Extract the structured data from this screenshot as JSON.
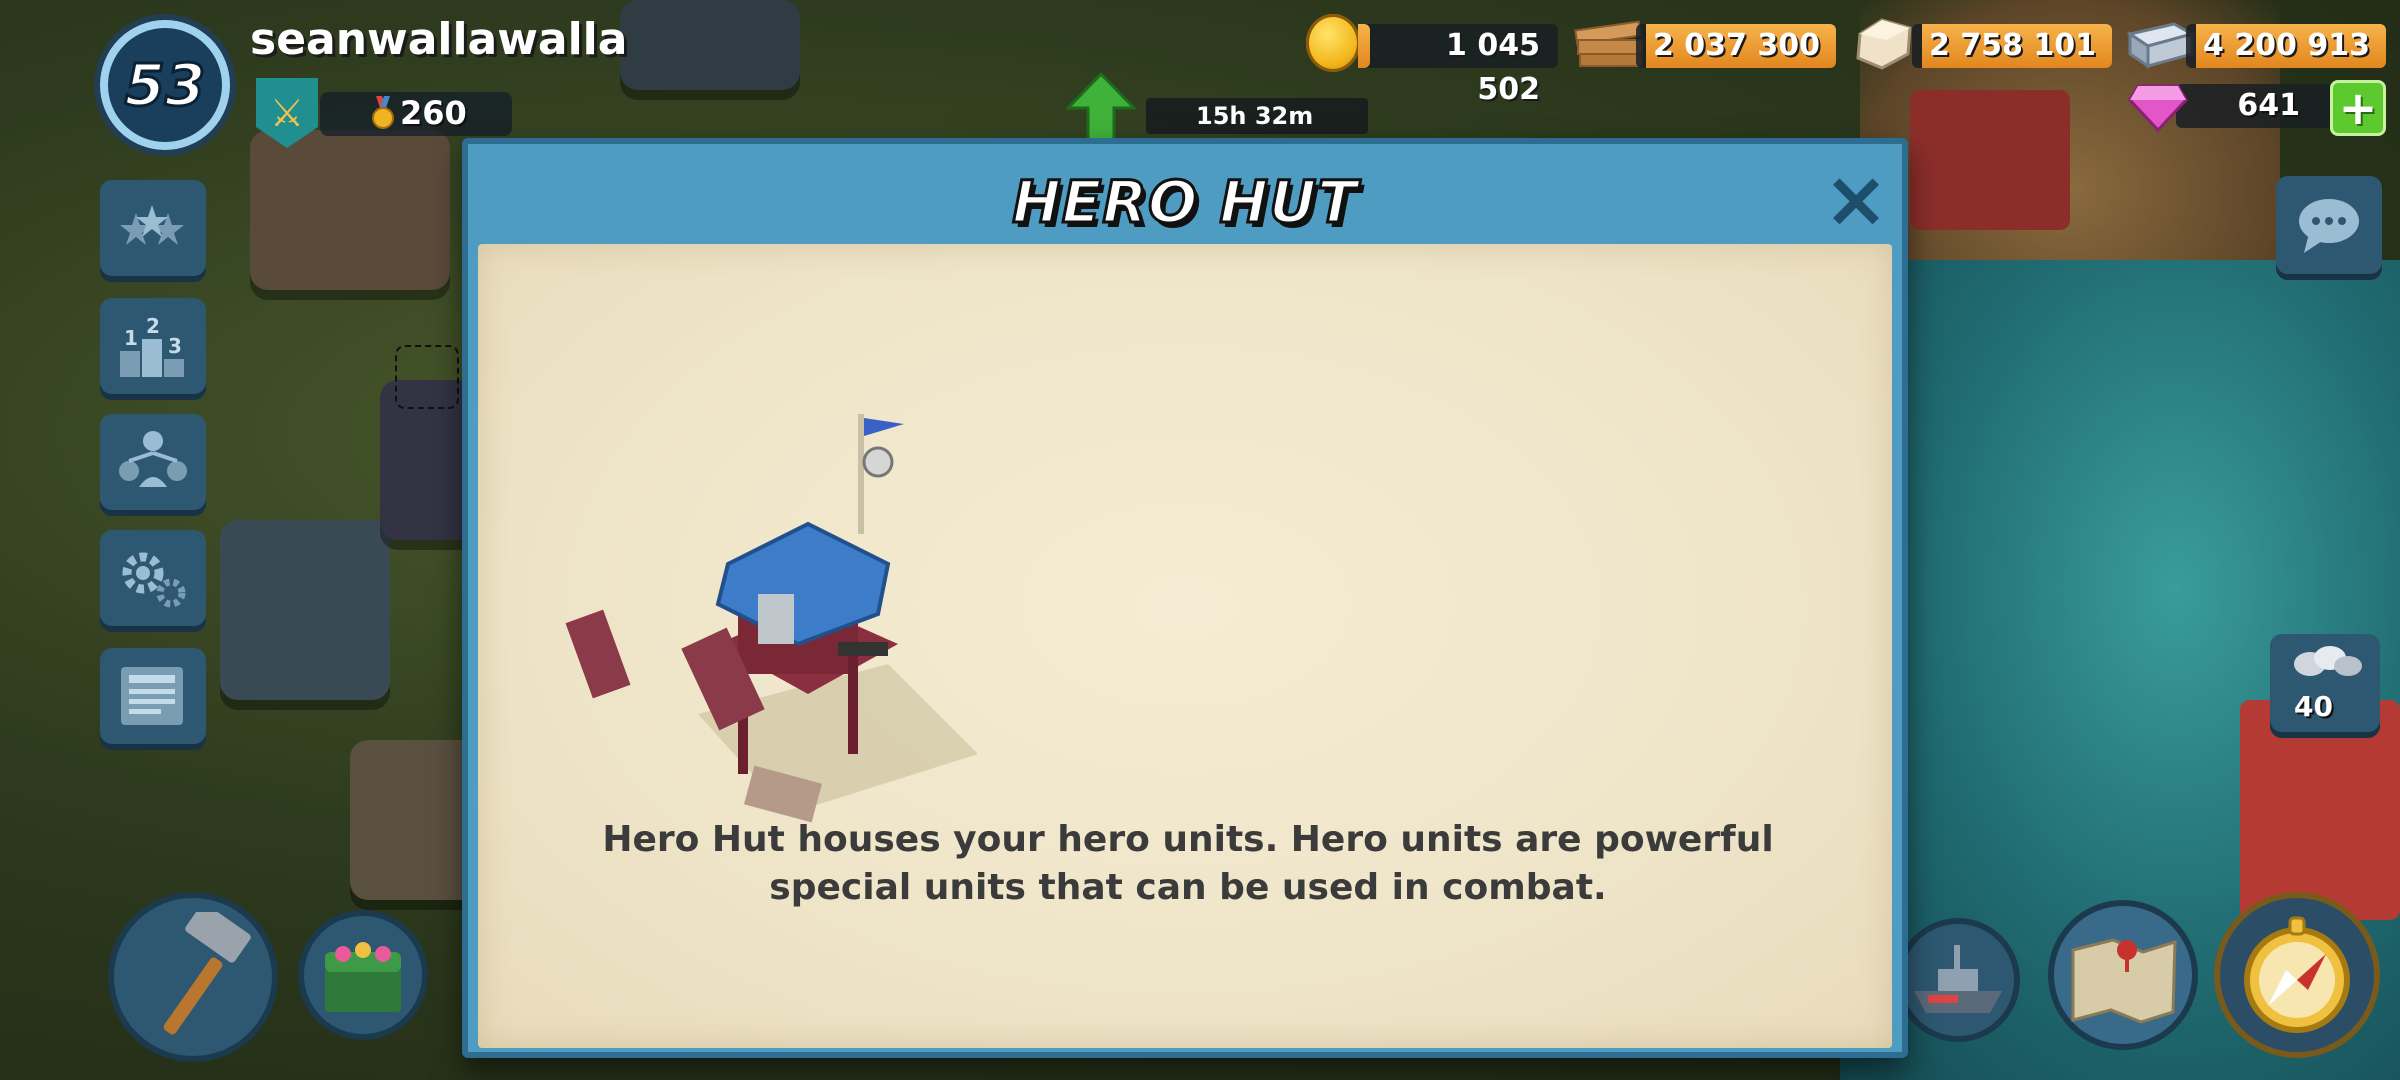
{
  "player": {
    "level": "53",
    "name": "seanwallawalla",
    "medals": "260"
  },
  "resources": {
    "gold": "1 045 502",
    "wood": "2 037 300",
    "stone": "2 758 101",
    "iron": "4 200 913",
    "diamonds": "641"
  },
  "timer": "15h 32m",
  "troop_count": "40",
  "dialog": {
    "title": "HERO HUT",
    "description_line1": "Hero Hut houses your hero units. Hero units are powerful",
    "description_line2": "special units that can be used in combat.",
    "close_icon": "close-icon"
  },
  "side_menu": [
    {
      "icon": "stars-icon"
    },
    {
      "icon": "leaderboard-icon"
    },
    {
      "icon": "task-force-icon"
    },
    {
      "icon": "settings-icon"
    },
    {
      "icon": "newspaper-icon"
    }
  ],
  "colors": {
    "dialog_frame": "#4f9cc2",
    "parchment": "#f4ecd4",
    "resource_bar": "#f7b34b",
    "plus_button": "#5cc92f"
  }
}
